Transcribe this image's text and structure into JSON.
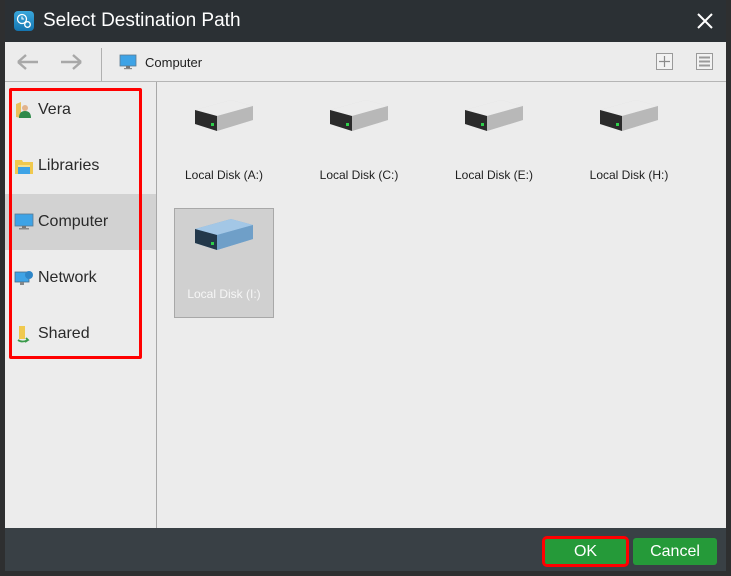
{
  "window": {
    "title": "Select Destination Path",
    "app_icon": "backup-gear-icon",
    "close_icon": "close-icon"
  },
  "toolbar": {
    "back_icon": "arrow-left-icon",
    "forward_icon": "arrow-right-icon",
    "breadcrumb": {
      "icon": "computer-icon",
      "label": "Computer"
    },
    "new_folder_icon": "plus-icon",
    "view_icon": "list-view-icon"
  },
  "sidebar": {
    "items": [
      {
        "label": "Vera",
        "icon": "user-folder-icon",
        "selected": false
      },
      {
        "label": "Libraries",
        "icon": "libraries-icon",
        "selected": false
      },
      {
        "label": "Computer",
        "icon": "computer-icon",
        "selected": true
      },
      {
        "label": "Network",
        "icon": "network-icon",
        "selected": false
      },
      {
        "label": "Shared",
        "icon": "shared-folder-icon",
        "selected": false
      }
    ],
    "highlight_color": "#ff0000"
  },
  "content": {
    "drives": [
      {
        "label": "Local Disk (A:)",
        "selected": false
      },
      {
        "label": "Local Disk (C:)",
        "selected": false
      },
      {
        "label": "Local Disk (E:)",
        "selected": false
      },
      {
        "label": "Local Disk (H:)",
        "selected": false
      },
      {
        "label": "Local Disk (I:)",
        "selected": true
      }
    ]
  },
  "footer": {
    "ok_label": "OK",
    "cancel_label": "Cancel",
    "button_color": "#259a39"
  }
}
